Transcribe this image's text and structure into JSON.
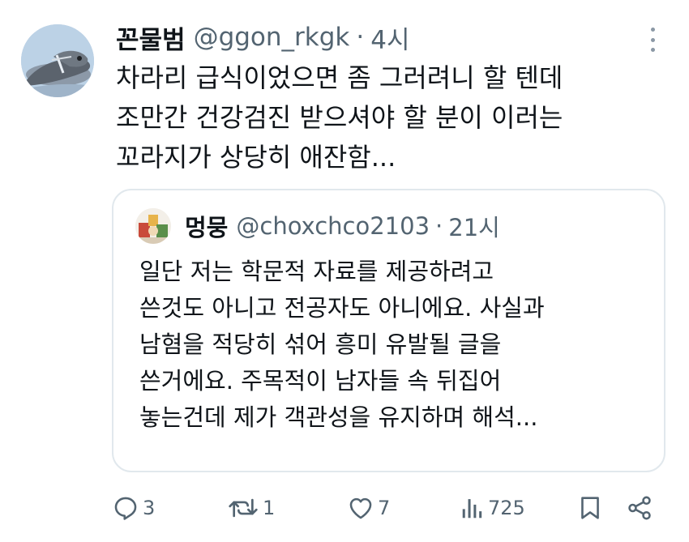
{
  "tweet": {
    "display_name": "꼰물범",
    "handle": "@ggon_rkgk",
    "separator": "·",
    "time": "4시",
    "text_lines": [
      "차라리 급식이었으면 좀 그러려니 할 텐데",
      "조만간 건강검진 받으셔야 할 분이 이러는",
      "꼬라지가 상당히 애잔함..."
    ]
  },
  "quote": {
    "display_name": "멍뭉",
    "handle": "@choxchco2103",
    "separator": "·",
    "time": "21시",
    "text_lines": [
      "일단 저는 학문적 자료를 제공하려고",
      "쓴것도 아니고 전공자도 아니에요. 사실과",
      "남혐을 적당히 섞어 흥미 유발될 글을",
      "쓴거에요. 주목적이 남자들 속 뒤집어",
      "놓는건데 제가 객관성을 유지하며 해석..."
    ]
  },
  "actions": {
    "reply_count": "3",
    "retweet_count": "1",
    "like_count": "7",
    "views_count": "725"
  },
  "icons": {
    "reply": "reply-icon",
    "retweet": "retweet-icon",
    "like": "heart-icon",
    "views": "views-icon",
    "bookmark": "bookmark-icon",
    "share": "share-icon",
    "more": "more-icon"
  },
  "colors": {
    "text_primary": "#0f1419",
    "text_secondary": "#536471",
    "border": "#e1e8ed",
    "background": "#ffffff"
  }
}
